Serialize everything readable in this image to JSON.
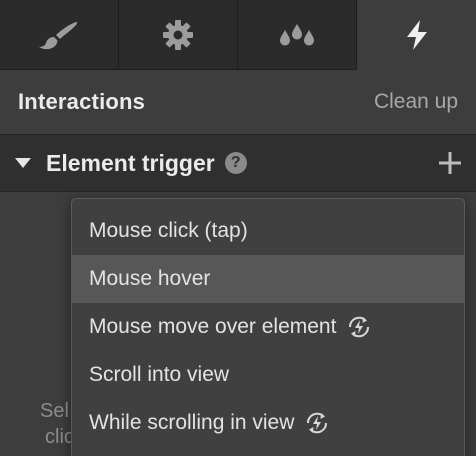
{
  "tabs": [
    {
      "icon": "brush-icon",
      "active": false
    },
    {
      "icon": "gear-icon",
      "active": false
    },
    {
      "icon": "drops-icon",
      "active": false
    },
    {
      "icon": "lightning-icon",
      "active": true
    }
  ],
  "header": {
    "title": "Interactions",
    "cleanup_label": "Clean up"
  },
  "trigger": {
    "title": "Element trigger",
    "help_icon": "?"
  },
  "menu": {
    "items": [
      {
        "label": "Mouse click (tap)",
        "hover": false,
        "cycle_icon": false
      },
      {
        "label": "Mouse hover",
        "hover": true,
        "cycle_icon": false
      },
      {
        "label": "Mouse move over element",
        "hover": false,
        "cycle_icon": true
      },
      {
        "label": "Scroll into view",
        "hover": false,
        "cycle_icon": false
      },
      {
        "label": "While scrolling in view",
        "hover": false,
        "cycle_icon": true
      }
    ]
  },
  "background_hint": {
    "line1": "Sel",
    "line2": "clic"
  },
  "colors": {
    "panel_bg": "#3d3d3d",
    "tab_bg": "#2b2b2b",
    "menu_bg": "#404040",
    "menu_hover": "#575757"
  }
}
